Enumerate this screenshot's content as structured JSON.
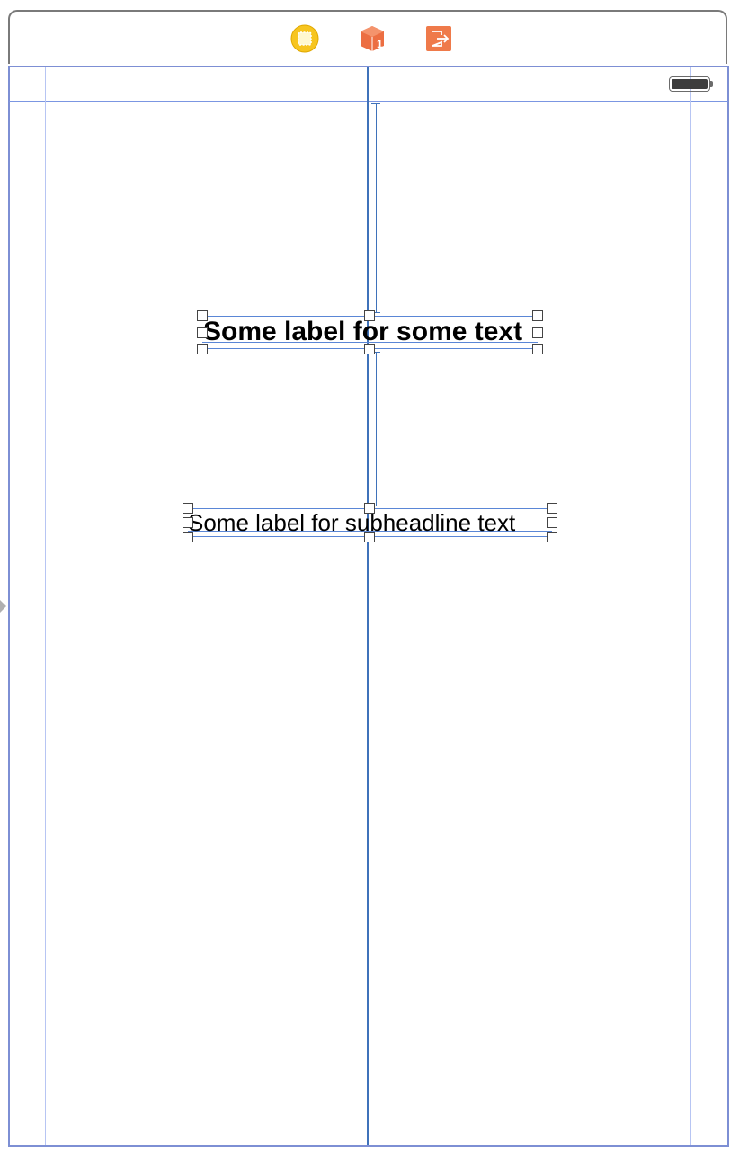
{
  "scene_dock": {
    "icons": [
      {
        "name": "view-controller-icon",
        "color": "#f5c21b"
      },
      {
        "name": "first-responder-icon",
        "color": "#ec6e42",
        "glyph": "1"
      },
      {
        "name": "exit-icon",
        "color": "#ef7a4a"
      }
    ]
  },
  "status_bar": {
    "battery_icon": "battery-icon"
  },
  "labels": {
    "headline": "Some label for some text",
    "subheadline": "Some label for subheadline text"
  },
  "colors": {
    "selection": "#5a86d6",
    "guide": "#3f72ba",
    "margin": "#b7c5f3"
  }
}
